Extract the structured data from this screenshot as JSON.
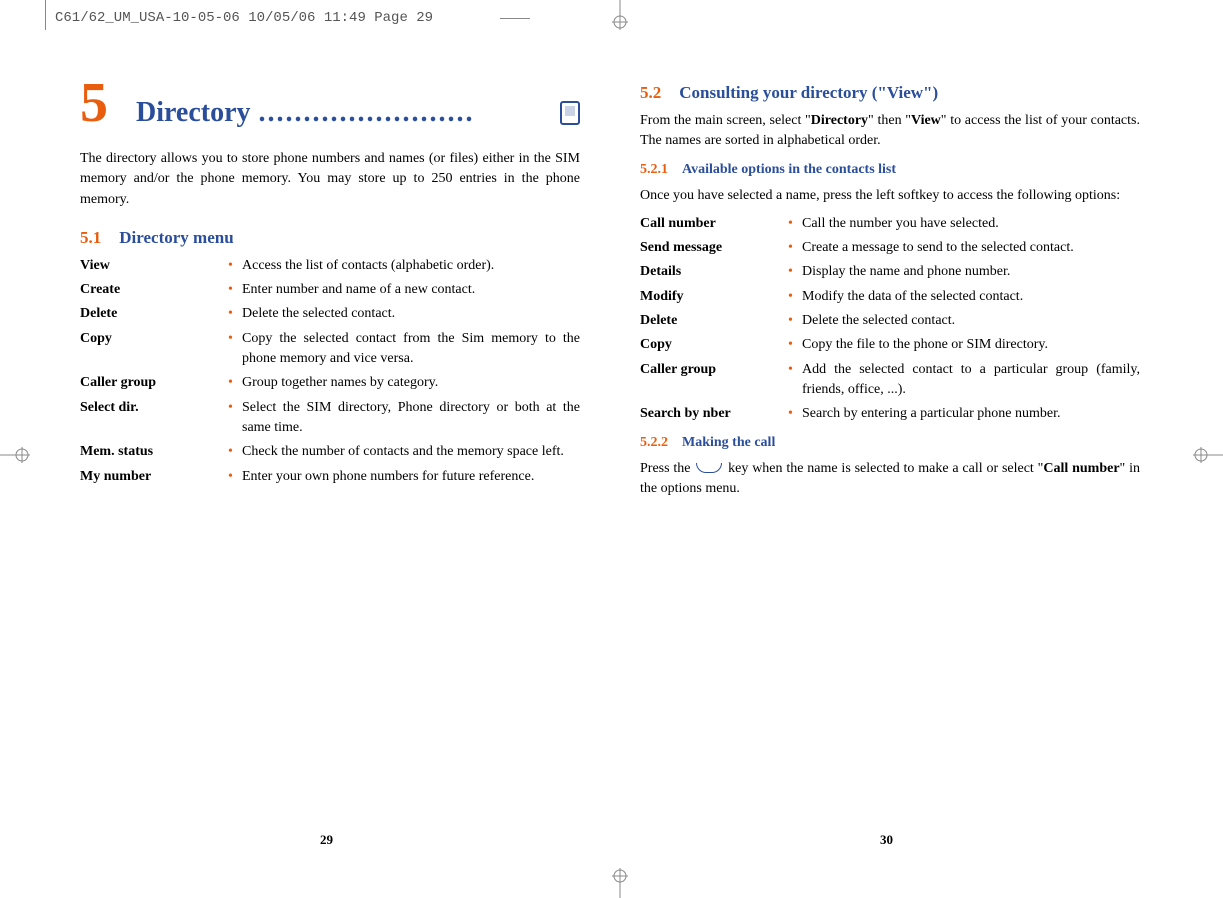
{
  "crop_header": "C61/62_UM_USA-10-05-06  10/05/06  11:49  Page 29",
  "left": {
    "chapter_num": "5",
    "chapter_title": "Directory",
    "dots": "........................",
    "intro": "The directory allows you to store phone numbers and names (or files) either in the SIM memory and/or the phone memory. You may store up to 250 entries in the phone memory.",
    "section_num": "5.1",
    "section_title": "Directory menu",
    "items": [
      {
        "term": "View",
        "desc": "Access the list of contacts (alphabetic order)."
      },
      {
        "term": "Create",
        "desc": "Enter number and name of a new contact."
      },
      {
        "term": "Delete",
        "desc": "Delete the selected contact."
      },
      {
        "term": "Copy",
        "desc": "Copy the selected contact from the Sim memory to the phone memory and vice versa."
      },
      {
        "term": "Caller group",
        "desc": "Group together names by category."
      },
      {
        "term": "Select dir.",
        "desc": "Select the SIM directory, Phone directory or both at the same time."
      },
      {
        "term": "Mem. status",
        "desc": "Check the number of contacts and the memory space left."
      },
      {
        "term": "My number",
        "desc": "Enter your own phone numbers for future reference."
      }
    ],
    "page_num": "29"
  },
  "right": {
    "section_num": "5.2",
    "section_title": "Consulting your directory (\"View\")",
    "intro_pre": "From the main screen, select \"",
    "intro_b1": "Directory",
    "intro_mid": "\" then \"",
    "intro_b2": "View",
    "intro_post": "\" to access the list of your contacts. The names are sorted in alphabetical order.",
    "sub1_num": "5.2.1",
    "sub1_title": "Available options in the contacts list",
    "sub1_intro": "Once you have selected a name, press the left softkey to access the following options:",
    "items": [
      {
        "term": "Call number",
        "desc": "Call the number you have selected."
      },
      {
        "term": "Send message",
        "desc": "Create a message to send to the selected contact."
      },
      {
        "term": "Details",
        "desc": "Display the name and phone number."
      },
      {
        "term": "Modify",
        "desc": "Modify the data of the selected contact."
      },
      {
        "term": "Delete",
        "desc": "Delete the selected contact."
      },
      {
        "term": "Copy",
        "desc": "Copy the file to the phone or SIM directory."
      },
      {
        "term": "Caller group",
        "desc": "Add the selected contact to a particular group (family, friends, office, ...)."
      },
      {
        "term": "Search by nber",
        "desc": "Search by entering a particular phone number."
      }
    ],
    "sub2_num": "5.2.2",
    "sub2_title": "Making the call",
    "call_pre": "Press the ",
    "call_mid": " key when the name is selected to make a call or select \"",
    "call_bold": "Call number",
    "call_post": "\" in the options menu.",
    "page_num": "30"
  }
}
